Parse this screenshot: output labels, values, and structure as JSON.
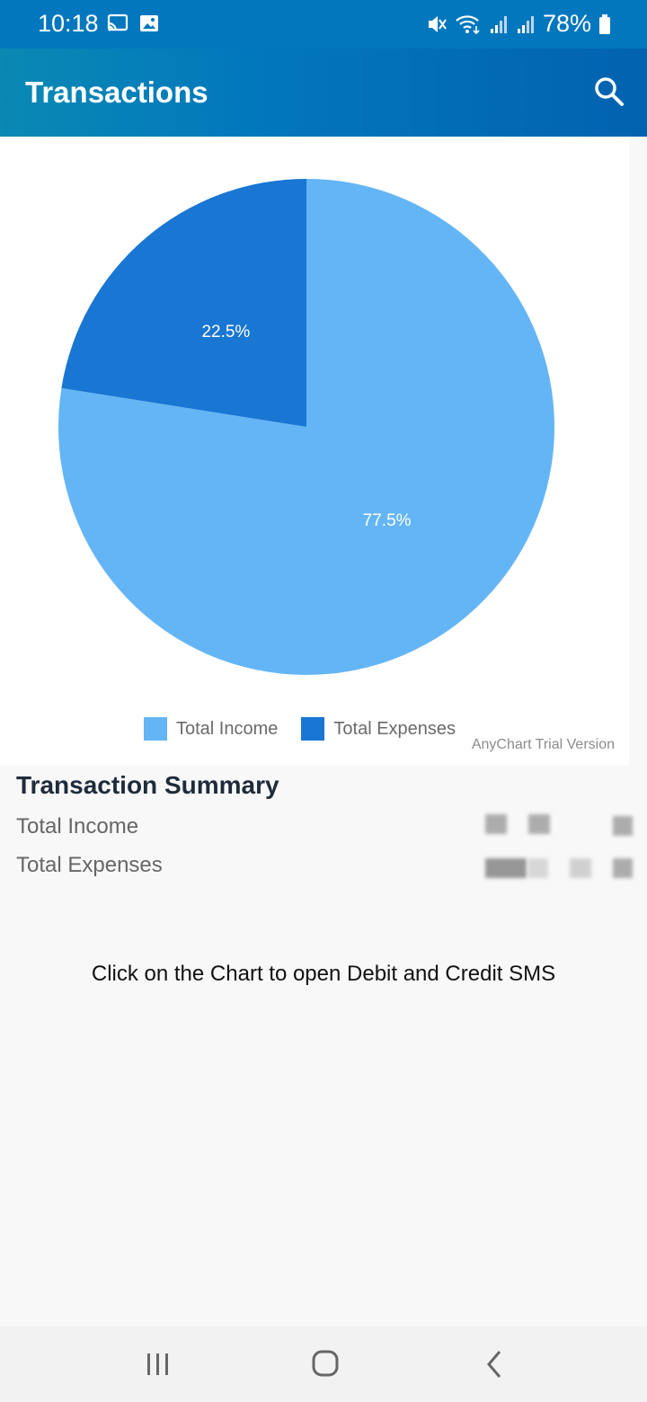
{
  "status_bar": {
    "time": "10:18",
    "battery": "78%",
    "left_icons": [
      "cast-icon",
      "image-icon"
    ],
    "right_icons": [
      "mute-icon",
      "wifi-icon",
      "signal-icon",
      "signal-icon",
      "battery-icon"
    ]
  },
  "app_bar": {
    "title": "Transactions",
    "search_icon": "search-icon"
  },
  "chart_data": {
    "type": "pie",
    "series": [
      {
        "name": "Total Income",
        "value": 77.5,
        "label": "77.5%",
        "color": "#64b5f6"
      },
      {
        "name": "Total Expenses",
        "value": 22.5,
        "label": "22.5%",
        "color": "#1976d2"
      }
    ],
    "legend_position": "bottom",
    "watermark": "AnyChart Trial Version"
  },
  "summary": {
    "title": "Transaction Summary",
    "rows": [
      {
        "label": "Total Income"
      },
      {
        "label": "Total Expenses"
      }
    ]
  },
  "hint_text": "Click on the Chart to open Debit and Credit SMS",
  "nav_bar": {
    "buttons": [
      "recent-apps-icon",
      "home-icon",
      "back-icon"
    ]
  }
}
